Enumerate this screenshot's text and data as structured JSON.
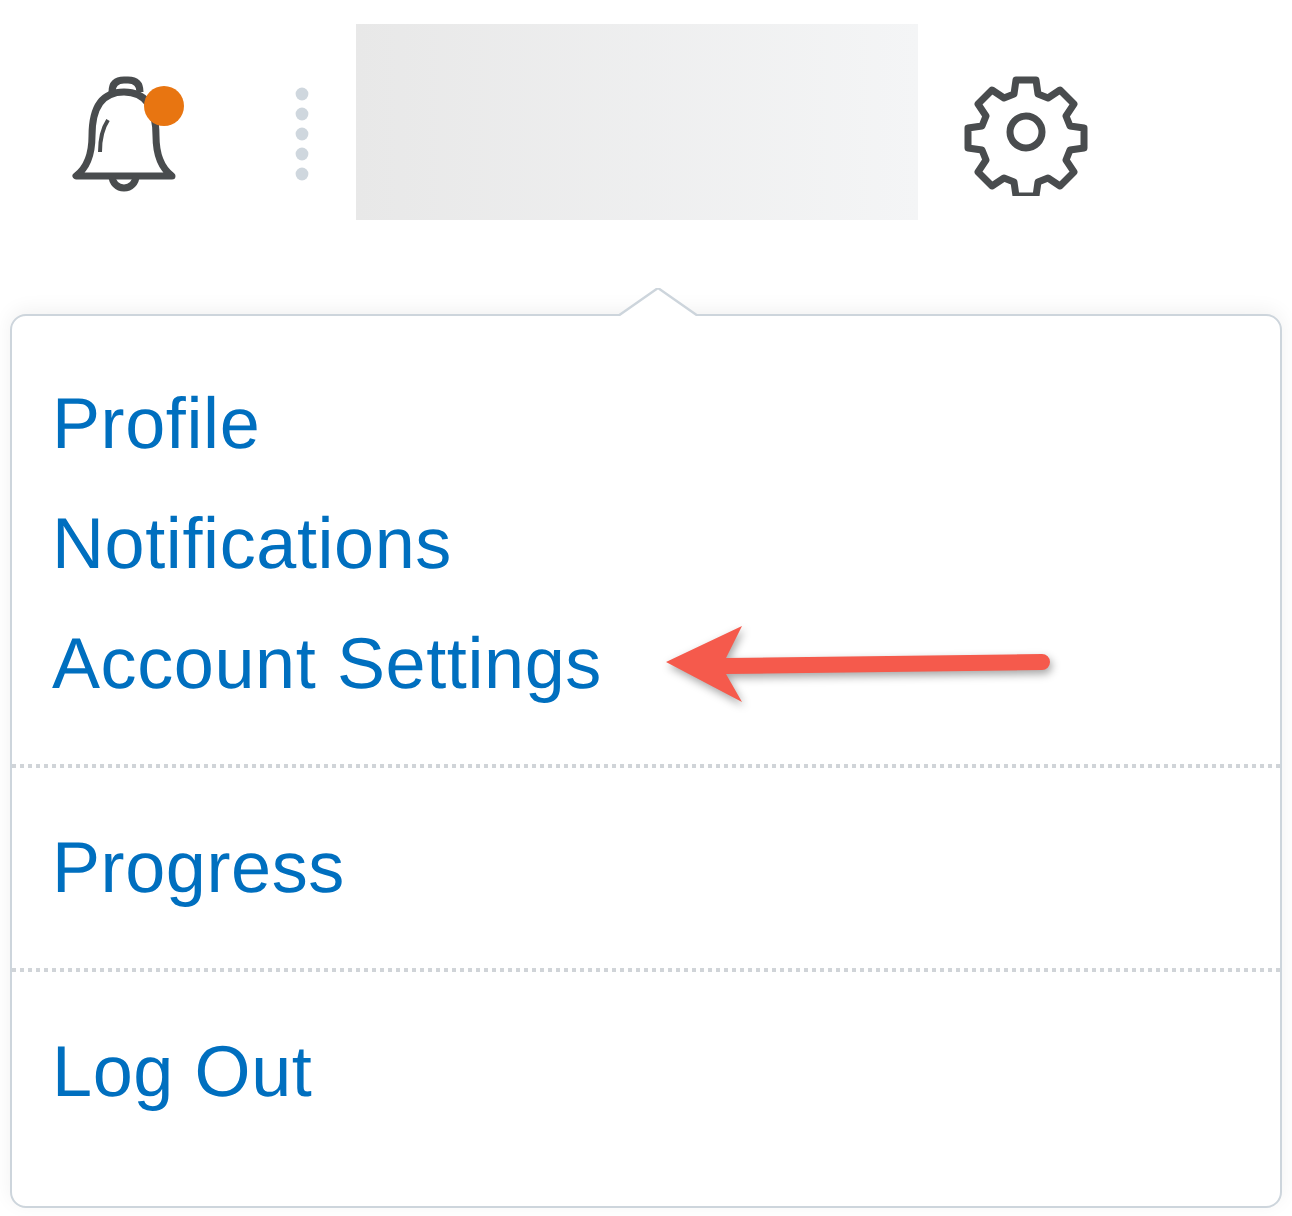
{
  "header": {
    "notifications": {
      "unread": true
    }
  },
  "menu": {
    "groups": [
      {
        "items": [
          {
            "label": "Profile",
            "callout": false
          },
          {
            "label": "Notifications",
            "callout": false
          },
          {
            "label": "Account Settings",
            "callout": true
          }
        ]
      },
      {
        "items": [
          {
            "label": "Progress",
            "callout": false
          }
        ]
      },
      {
        "items": [
          {
            "label": "Log Out",
            "callout": false
          }
        ]
      }
    ]
  }
}
